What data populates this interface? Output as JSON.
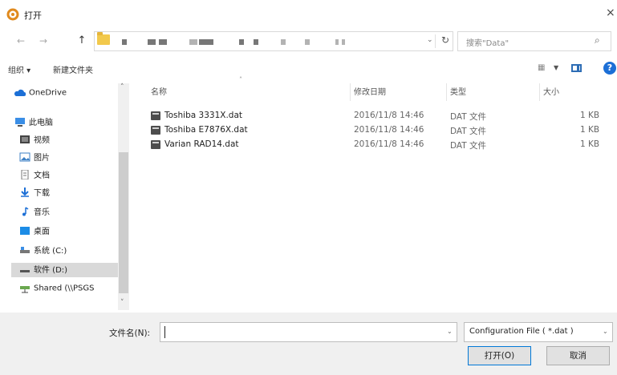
{
  "window": {
    "title": "打开",
    "close_symbol": "×"
  },
  "nav": {
    "back_symbol": "←",
    "forward_symbol": "→",
    "up_symbol": "↑",
    "address_dropdown_symbol": "⌄",
    "refresh_symbol": "↻",
    "search_placeholder": "搜索\"Data\"",
    "search_symbol": "⌕"
  },
  "toolbar": {
    "organize_label": "组织 ▾",
    "new_folder_label": "新建文件夹",
    "help_symbol": "?"
  },
  "sidebar": {
    "items": [
      {
        "label": "OneDrive",
        "icon": "cloud-icon"
      },
      {
        "label": "此电脑",
        "icon": "computer-icon"
      },
      {
        "label": "视频",
        "icon": "video-icon"
      },
      {
        "label": "图片",
        "icon": "picture-icon"
      },
      {
        "label": "文档",
        "icon": "document-icon"
      },
      {
        "label": "下载",
        "icon": "download-icon"
      },
      {
        "label": "音乐",
        "icon": "music-icon"
      },
      {
        "label": "桌面",
        "icon": "desktop-icon"
      },
      {
        "label": "系统 (C:)",
        "icon": "drive-icon"
      },
      {
        "label": "软件 (D:)",
        "icon": "drive-icon"
      },
      {
        "label": "Shared (\\\\PSGS",
        "icon": "network-drive-icon"
      }
    ],
    "scroll_up": "˄",
    "scroll_down": "˅"
  },
  "file_list": {
    "columns": {
      "name": "名称",
      "date": "修改日期",
      "type": "类型",
      "size": "大小"
    },
    "rows": [
      {
        "name": "Toshiba 3331X.dat",
        "date": "2016/11/8 14:46",
        "type": "DAT 文件",
        "size": "1 KB"
      },
      {
        "name": "Toshiba E7876X.dat",
        "date": "2016/11/8 14:46",
        "type": "DAT 文件",
        "size": "1 KB"
      },
      {
        "name": "Varian RAD14.dat",
        "date": "2016/11/8 14:46",
        "type": "DAT 文件",
        "size": "1 KB"
      }
    ]
  },
  "bottom": {
    "filename_label": "文件名(N):",
    "filename_value": "",
    "filter_value": "Configuration File ( *.dat )",
    "open_button": "打开(O)",
    "cancel_button": "取消"
  },
  "colors": {
    "accent": "#0078d7",
    "folder": "#f2c94c",
    "help": "#1c6fd6"
  }
}
